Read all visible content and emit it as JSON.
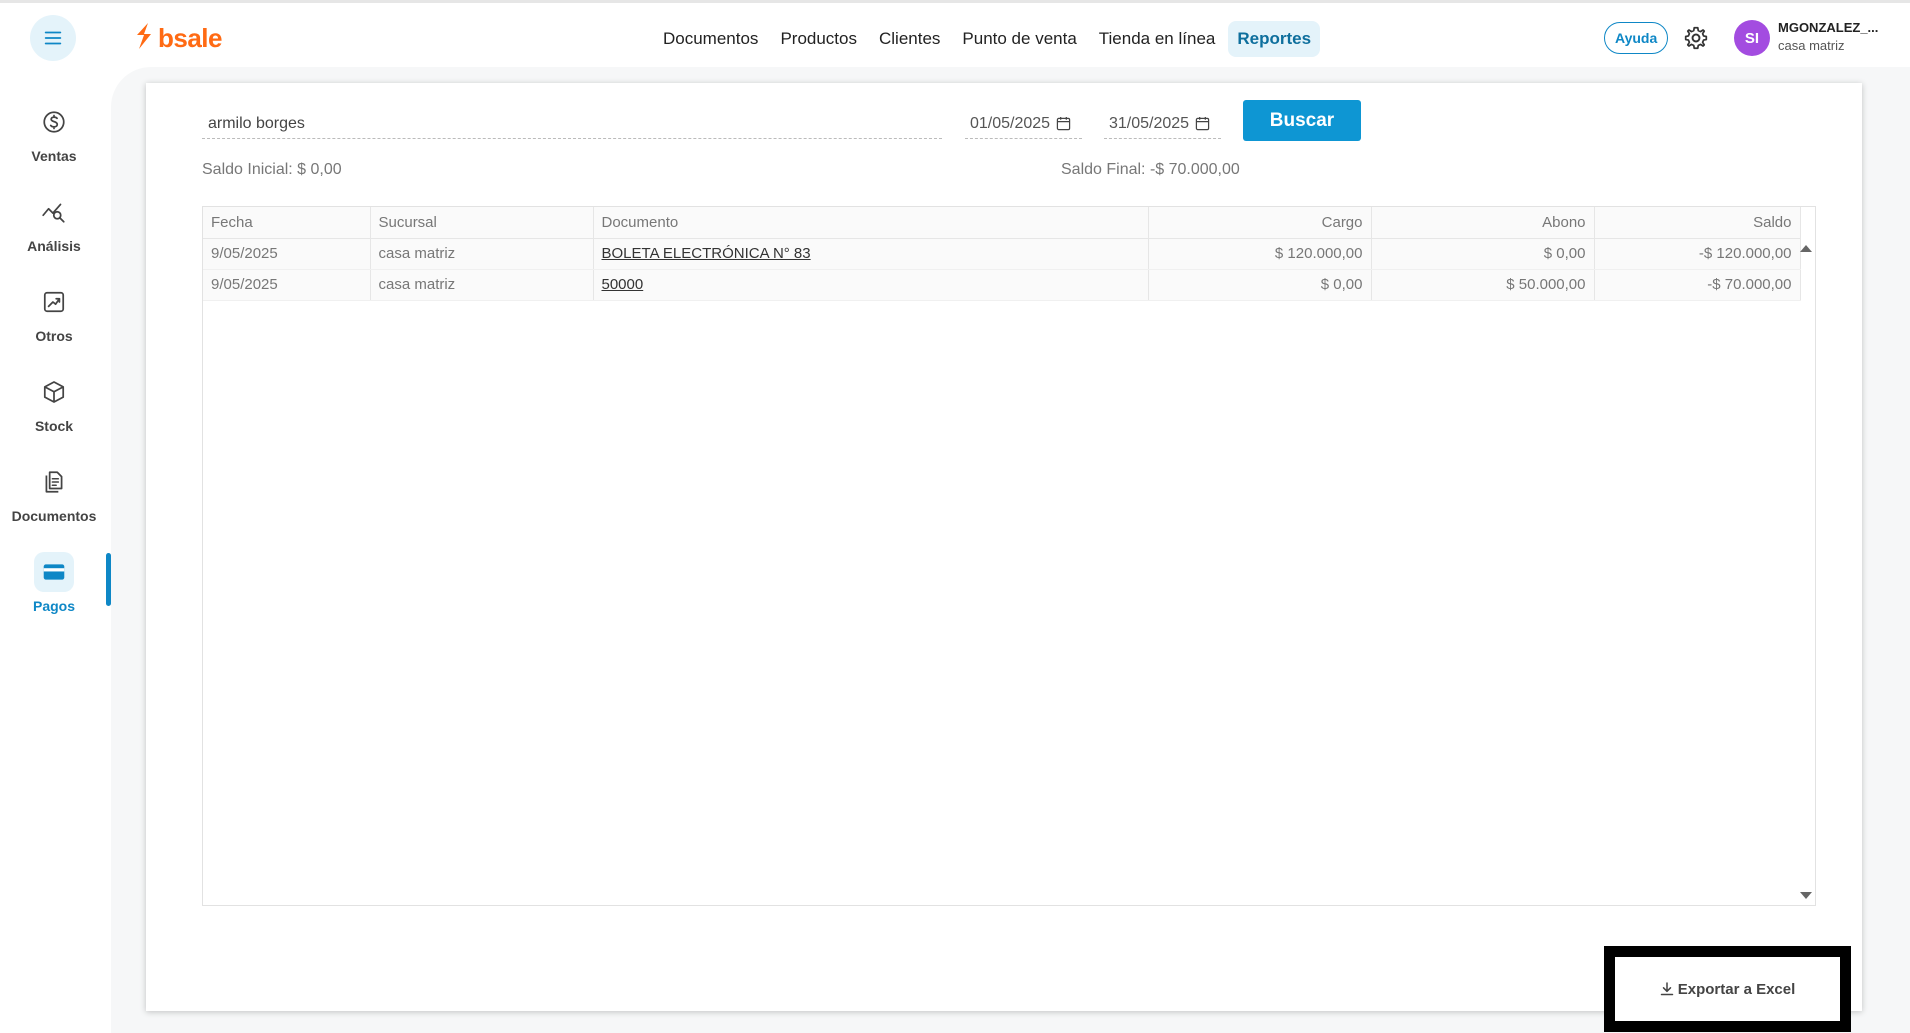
{
  "brand": {
    "name": "bsale"
  },
  "nav": {
    "items": [
      {
        "label": "Documentos"
      },
      {
        "label": "Productos"
      },
      {
        "label": "Clientes"
      },
      {
        "label": "Punto de venta"
      },
      {
        "label": "Tienda en línea"
      },
      {
        "label": "Reportes",
        "active": true
      }
    ]
  },
  "user": {
    "help_label": "Ayuda",
    "initials": "SI",
    "name": "MGONZALEZ_...",
    "branch": "casa matriz"
  },
  "sidebar": {
    "items": [
      {
        "label": "Ventas",
        "icon": "dollar-icon"
      },
      {
        "label": "Análisis",
        "icon": "analysis-icon"
      },
      {
        "label": "Otros",
        "icon": "chart-icon"
      },
      {
        "label": "Stock",
        "icon": "box-icon"
      },
      {
        "label": "Documentos",
        "icon": "document-icon"
      },
      {
        "label": "Pagos",
        "icon": "card-icon",
        "active": true
      }
    ]
  },
  "filters": {
    "client": "armilo borges",
    "date_from": "01/05/2025",
    "date_to": "31/05/2025",
    "search_label": "Buscar"
  },
  "summary": {
    "saldo_inicial": "Saldo Inicial: $ 0,00",
    "saldo_final": "Saldo Final: -$ 70.000,00"
  },
  "table": {
    "headers": [
      "Fecha",
      "Sucursal",
      "Documento",
      "Cargo",
      "Abono",
      "Saldo"
    ],
    "rows": [
      [
        "9/05/2025",
        "casa matriz",
        "BOLETA ELECTRÓNICA N° 83",
        "$ 120.000,00",
        "$ 0,00",
        "-$ 120.000,00"
      ],
      [
        "9/05/2025",
        "casa matriz",
        "50000",
        "$ 0,00",
        "$ 50.000,00",
        "-$ 70.000,00"
      ]
    ]
  },
  "export": {
    "label": "Exportar a Excel"
  },
  "colors": {
    "accent": "#0e96d3",
    "brand": "#ff6a13",
    "avatar": "#a34ce0"
  }
}
